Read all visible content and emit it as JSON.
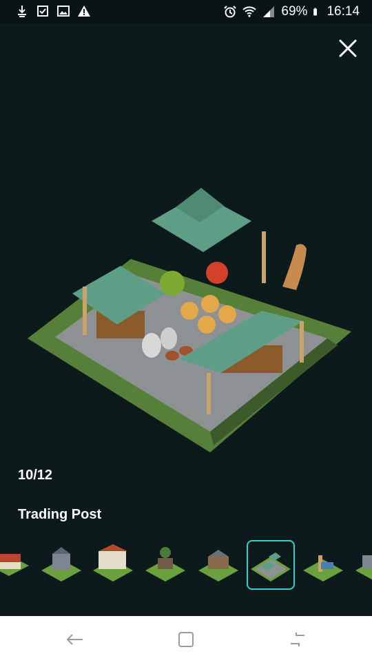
{
  "status_bar": {
    "battery_percent": "69%",
    "time": "16:14",
    "left_icons": [
      "download-icon",
      "checkbox-icon",
      "image-icon",
      "warning-icon"
    ],
    "right_icons": [
      "alarm-icon",
      "wifi-icon",
      "signal-icon",
      "battery-icon"
    ]
  },
  "viewer": {
    "counter": "10/12",
    "title": "Trading Post",
    "selected_index": 5
  },
  "colors": {
    "background": "#0d1a1c",
    "accent": "#2fd0cf",
    "canopy": "#5f9e86",
    "grass": "#5f8a3a"
  },
  "nav_bar": {
    "buttons": [
      "back-icon",
      "recents-icon",
      "home-icon"
    ]
  }
}
